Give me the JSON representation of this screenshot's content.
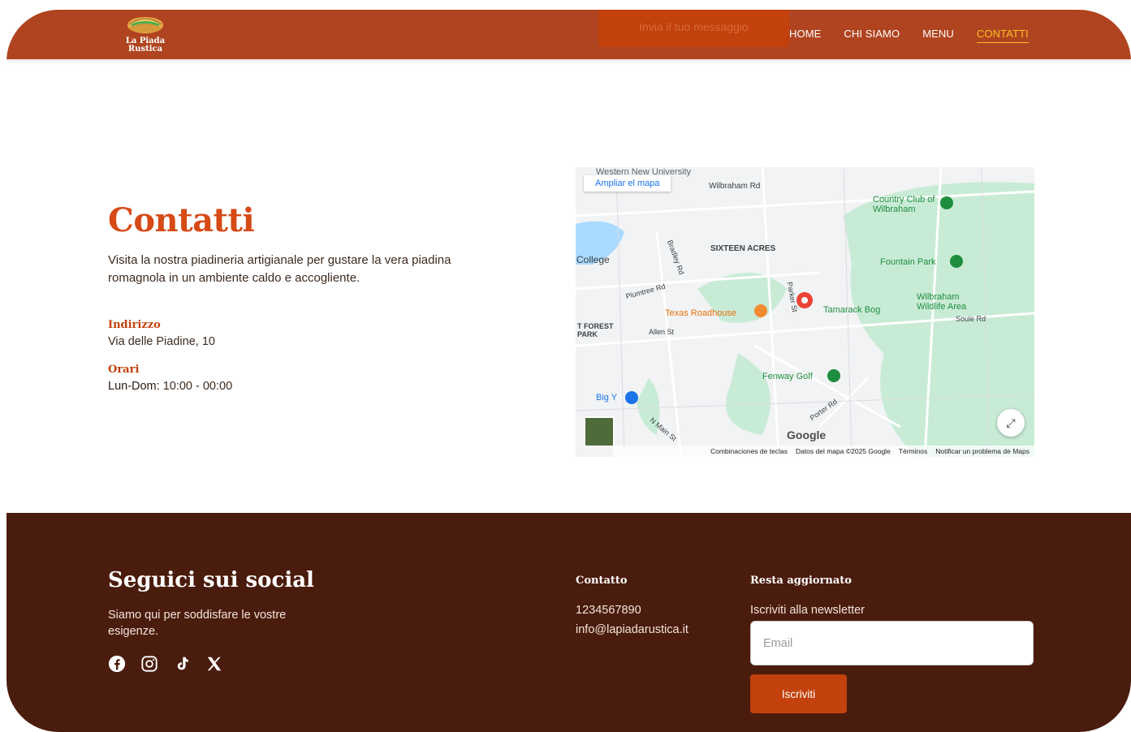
{
  "header": {
    "logo_text_line1": "La Piada",
    "logo_text_line2": "Rustica",
    "ghost_button": "Invia il tuo messaggio",
    "nav": [
      "HOME",
      "CHI SIAMO",
      "MENU",
      "CONTATTI"
    ],
    "active_nav": "CONTATTI"
  },
  "contact": {
    "title": "Contatti",
    "description": "Visita la nostra piadineria artigianale per gustare la vera piadina romagnola in un ambiente caldo e accogliente.",
    "address_label": "Indirizzo",
    "address_value": "Via delle Piadine, 10",
    "hours_label": "Orari",
    "hours_days": "Lun-Dom:",
    "hours_time": " 10:00 - 00:00"
  },
  "map": {
    "enlarge_button": "Ampliar el mapa",
    "labels": {
      "university": "Western New University",
      "wilbraham_rd": "Wilbraham Rd",
      "sixteen_acres": "SIXTEEN ACRES",
      "country_club": "Country Club of Wilbraham",
      "college": "College",
      "fountain_park": "Fountain Park",
      "texas_roadhouse": "Texas Roadhouse",
      "tamarack_bog": "Tamarack Bog",
      "wildlife_area": "Wilbraham Wildlife Area",
      "forest_park": "T FOREST PARK",
      "allen_st": "Allen St",
      "fenway_golf": "Fenway Golf",
      "big_y": "Big Y",
      "soule_rd": "Soule Rd",
      "parker_st": "Parker St",
      "bradley_rd": "Bradley Rd",
      "plumtree_rd": "Plumtree Rd",
      "porter_rd": "Porter Rd",
      "n_main_st": "N Main St"
    },
    "google": "Google",
    "footer": [
      "Combinaciones de teclas",
      "Datos del mapa ©2025 Google",
      "Términos",
      "Notificar un problema de Maps"
    ]
  },
  "footer": {
    "social_title": "Seguici sui social",
    "social_sub": "Siamo qui per soddisfare le vostre esigenze.",
    "social_icons": [
      "facebook-icon",
      "instagram-icon",
      "tiktok-icon",
      "x-icon"
    ],
    "contact_heading": "Contatto",
    "phone": "1234567890",
    "email": "info@lapiadarustica.it",
    "newsletter_heading": "Resta aggiornato",
    "newsletter_label": "Iscriviti alla newsletter",
    "email_placeholder": "Email",
    "subscribe_button": "Iscriviti"
  },
  "colors": {
    "header_bg": "#b04420",
    "accent": "#c2410c",
    "title": "#d64a16",
    "nav_active": "#fbbf24",
    "footer_bg": "#4a1c0d"
  }
}
